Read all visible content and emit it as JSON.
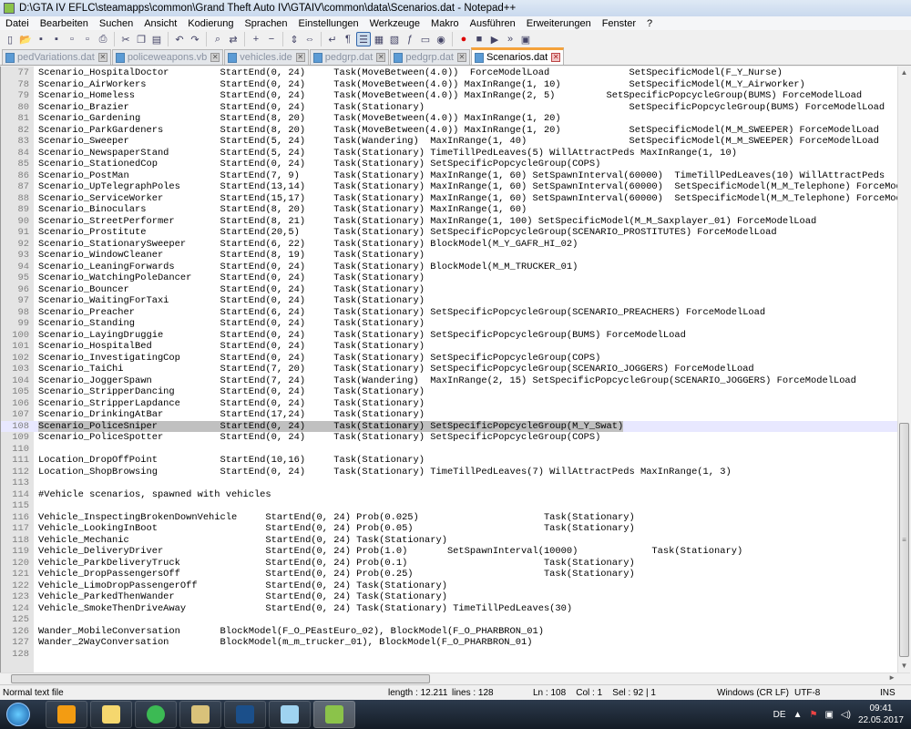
{
  "window": {
    "title": "D:\\GTA IV EFLC\\steamapps\\common\\Grand Theft Auto IV\\GTAIV\\common\\data\\Scenarios.dat - Notepad++"
  },
  "menu": [
    "Datei",
    "Bearbeiten",
    "Suchen",
    "Ansicht",
    "Kodierung",
    "Sprachen",
    "Einstellungen",
    "Werkzeuge",
    "Makro",
    "Ausführen",
    "Erweiterungen",
    "Fenster",
    "?"
  ],
  "toolbar": [
    "new-file",
    "open",
    "save",
    "save-all",
    "close",
    "close-all",
    "print",
    "|",
    "cut",
    "copy",
    "paste",
    "|",
    "undo",
    "redo",
    "|",
    "find",
    "replace",
    "|",
    "zoom-in",
    "zoom-out",
    "|",
    "sync-v",
    "sync-h",
    "|",
    "word-wrap",
    "all-chars",
    "indent-guide",
    "udl",
    "doc-map",
    "function-list",
    "folder-workspace",
    "monitoring",
    "|",
    "record-macro",
    "stop-macro",
    "play-macro",
    "run-macro-multiple",
    "save-macro"
  ],
  "tabs": [
    {
      "label": "pedVariations.dat",
      "active": false
    },
    {
      "label": "policeweapons.vb",
      "active": false
    },
    {
      "label": "vehicles.ide",
      "active": false
    },
    {
      "label": "pedgrp.dat",
      "active": false
    },
    {
      "label": "pedgrp.dat",
      "active": false
    },
    {
      "label": "Scenarios.dat",
      "active": true
    }
  ],
  "editor": {
    "first_line": 77,
    "current_line": 108,
    "lines": [
      "Scenario_HospitalDoctor         StartEnd(0, 24)     Task(MoveBetween(4.0))  ForceModelLoad              SetSpecificModel(F_Y_Nurse)",
      "Scenario_AirWorkers             StartEnd(0, 24)     Task(MoveBetween(4.0)) MaxInRange(1, 10)            SetSpecificModel(M_Y_Airworker)",
      "Scenario_Homeless               StartEnd(0, 24)     Task(MoveBetween(4.0)) MaxInRange(2, 5)         SetSpecificPopcycleGroup(BUMS) ForceModelLoad",
      "Scenario_Brazier                StartEnd(0, 24)     Task(Stationary)                                    SetSpecificPopcycleGroup(BUMS) ForceModelLoad",
      "Scenario_Gardening              StartEnd(8, 20)     Task(MoveBetween(4.0)) MaxInRange(1, 20)",
      "Scenario_ParkGardeners          StartEnd(8, 20)     Task(MoveBetween(4.0)) MaxInRange(1, 20)            SetSpecificModel(M_M_SWEEPER) ForceModelLoad",
      "Scenario_Sweeper                StartEnd(5, 24)     Task(Wandering)  MaxInRange(1, 40)                  SetSpecificModel(M_M_SWEEPER) ForceModelLoad",
      "Scenario_NewspaperStand         StartEnd(5, 24)     Task(Stationary) TimeTillPedLeaves(5) WillAttractPeds MaxInRange(1, 10)",
      "Scenario_StationedCop           StartEnd(0, 24)     Task(Stationary) SetSpecificPopcycleGroup(COPS)",
      "Scenario_PostMan                StartEnd(7, 9)      Task(Stationary) MaxInRange(1, 60) SetSpawnInterval(60000)  TimeTillPedLeaves(10) WillAttractPeds",
      "Scenario_UpTelegraphPoles       StartEnd(13,14)     Task(Stationary) MaxInRange(1, 60) SetSpawnInterval(60000)  SetSpecificModel(M_M_Telephone) ForceModelLoad",
      "Scenario_ServiceWorker          StartEnd(15,17)     Task(Stationary) MaxInRange(1, 60) SetSpawnInterval(60000)  SetSpecificModel(M_M_Telephone) ForceModelLoad",
      "Scenario_Binoculars             StartEnd(8, 20)     Task(Stationary) MaxInRange(1, 60)",
      "Scenario_StreetPerformer        StartEnd(8, 21)     Task(Stationary) MaxInRange(1, 100) SetSpecificModel(M_M_Saxplayer_01) ForceModelLoad",
      "Scenario_Prostitute             StartEnd(20,5)      Task(Stationary) SetSpecificPopcycleGroup(SCENARIO_PROSTITUTES) ForceModelLoad",
      "Scenario_StationarySweeper      StartEnd(6, 22)     Task(Stationary) BlockModel(M_Y_GAFR_HI_02)",
      "Scenario_WindowCleaner          StartEnd(8, 19)     Task(Stationary)",
      "Scenario_LeaningForwards        StartEnd(0, 24)     Task(Stationary) BlockModel(M_M_TRUCKER_01)",
      "Scenario_WatchingPoleDancer     StartEnd(0, 24)     Task(Stationary)",
      "Scenario_Bouncer                StartEnd(0, 24)     Task(Stationary)",
      "Scenario_WaitingForTaxi         StartEnd(0, 24)     Task(Stationary)",
      "Scenario_Preacher               StartEnd(6, 24)     Task(Stationary) SetSpecificPopcycleGroup(SCENARIO_PREACHERS) ForceModelLoad",
      "Scenario_Standing               StartEnd(0, 24)     Task(Stationary)",
      "Scenario_LayingDruggie          StartEnd(0, 24)     Task(Stationary) SetSpecificPopcycleGroup(BUMS) ForceModelLoad",
      "Scenario_HospitalBed            StartEnd(0, 24)     Task(Stationary)",
      "Scenario_InvestigatingCop       StartEnd(0, 24)     Task(Stationary) SetSpecificPopcycleGroup(COPS)",
      "Scenario_TaiChi                 StartEnd(7, 20)     Task(Stationary) SetSpecificPopcycleGroup(SCENARIO_JOGGERS) ForceModelLoad",
      "Scenario_JoggerSpawn            StartEnd(7, 24)     Task(Wandering)  MaxInRange(2, 15) SetSpecificPopcycleGroup(SCENARIO_JOGGERS) ForceModelLoad",
      "Scenario_StripperDancing        StartEnd(0, 24)     Task(Stationary)",
      "Scenario_StripperLapdance       StartEnd(0, 24)     Task(Stationary)",
      "Scenario_DrinkingAtBar          StartEnd(17,24)     Task(Stationary)",
      "Scenario_PoliceSniper           StartEnd(0, 24)     Task(Stationary) SetSpecificPopcycleGroup(M_Y_Swat)",
      "Scenario_PoliceSpotter          StartEnd(0, 24)     Task(Stationary) SetSpecificPopcycleGroup(COPS)",
      "",
      "Location_DropOffPoint           StartEnd(10,16)     Task(Stationary)",
      "Location_ShopBrowsing           StartEnd(0, 24)     Task(Stationary) TimeTillPedLeaves(7) WillAttractPeds MaxInRange(1, 3)",
      "",
      "#Vehicle scenarios, spawned with vehicles",
      "",
      "Vehicle_InspectingBrokenDownVehicle     StartEnd(0, 24) Prob(0.025)                      Task(Stationary)",
      "Vehicle_LookingInBoot                   StartEnd(0, 24) Prob(0.05)                       Task(Stationary)",
      "Vehicle_Mechanic                        StartEnd(0, 24) Task(Stationary)",
      "Vehicle_DeliveryDriver                  StartEnd(0, 24) Prob(1.0)       SetSpawnInterval(10000)             Task(Stationary)",
      "Vehicle_ParkDeliveryTruck               StartEnd(0, 24) Prob(0.1)                        Task(Stationary)",
      "Vehicle_DropPassengersOff               StartEnd(0, 24) Prob(0.25)                       Task(Stationary)",
      "Vehicle_LimoDropPassengerOff            StartEnd(0, 24) Task(Stationary)",
      "Vehicle_ParkedThenWander                StartEnd(0, 24) Task(Stationary)",
      "Vehicle_SmokeThenDriveAway              StartEnd(0, 24) Task(Stationary) TimeTillPedLeaves(30)",
      "",
      "Wander_MobileConversation       BlockModel(F_O_PEastEuro_02), BlockModel(F_O_PHARBRON_01)",
      "Wander_2WayConversation         BlockModel(m_m_trucker_01), BlockModel(F_O_PHARBRON_01)",
      ""
    ]
  },
  "status": {
    "file_type": "Normal text file",
    "length": "length : 12.211",
    "lines": "lines : 128",
    "position": "Ln : 108    Col : 1    Sel : 92 | 1",
    "eol": "Windows (CR LF)",
    "encoding": "UTF-8",
    "mode": "INS"
  },
  "taskbar": {
    "apps": [
      {
        "name": "windows-media-player",
        "color": "#f39c12",
        "active": false
      },
      {
        "name": "file-explorer",
        "color": "#f5d76e",
        "active": false
      },
      {
        "name": "chrome",
        "color": "#3cba54",
        "active": false
      },
      {
        "name": "gta-iv",
        "color": "#d9c27a",
        "active": false
      },
      {
        "name": "steam",
        "color": "#1b4f8a",
        "active": false
      },
      {
        "name": "notepad",
        "color": "#9fd3f0",
        "active": false
      },
      {
        "name": "notepad-plus-plus",
        "color": "#8bc34a",
        "active": true
      }
    ],
    "language": "DE",
    "time": "09:41",
    "date": "22.05.2017"
  },
  "colors": {
    "current_line": "#e8e8ff",
    "selection": "#c0c0c0",
    "active_tab_accent": "#f4a23b"
  }
}
